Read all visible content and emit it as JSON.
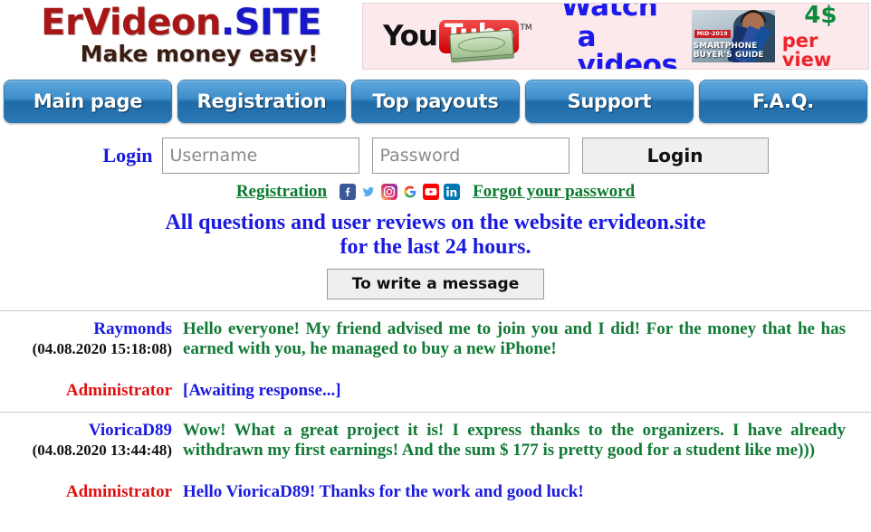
{
  "site": {
    "logo_primary": "ErVideon",
    "logo_dot": ".",
    "logo_suffix": "SITE",
    "logo_tagline": "Make money easy!"
  },
  "banner": {
    "brand_you": "You",
    "brand_tube": "Tube",
    "trademark": "TM",
    "headline_line1": "Watch",
    "headline_line2": "a videos",
    "thumb_tag": "MID-2019",
    "thumb_title": "SMARTPHONE\nBUYER'S GUIDE",
    "price": "4$",
    "price_sub": "per view"
  },
  "nav": {
    "items": [
      {
        "label": "Main page",
        "name": "nav-main-page"
      },
      {
        "label": "Registration",
        "name": "nav-registration"
      },
      {
        "label": "Top payouts",
        "name": "nav-top-payouts"
      },
      {
        "label": "Support",
        "name": "nav-support"
      },
      {
        "label": "F.A.Q.",
        "name": "nav-faq"
      }
    ]
  },
  "login": {
    "label": "Login",
    "username_placeholder": "Username",
    "username_value": "",
    "password_placeholder": "Password",
    "password_value": "",
    "submit_label": "Login"
  },
  "links": {
    "registration": "Registration",
    "forgot": "Forgot your password",
    "social": [
      {
        "name": "facebook-icon",
        "label": "Facebook",
        "color": "#3b5998"
      },
      {
        "name": "twitter-icon",
        "label": "Twitter",
        "color": "#55acee"
      },
      {
        "name": "instagram-icon",
        "label": "Instagram",
        "color": "#e1306c"
      },
      {
        "name": "google-icon",
        "label": "Google",
        "color": "#4285f4"
      },
      {
        "name": "youtube-icon",
        "label": "YouTube",
        "color": "#ff0000"
      },
      {
        "name": "linkedin-icon",
        "label": "LinkedIn",
        "color": "#0077b5"
      }
    ]
  },
  "headline": {
    "line1": "All questions and user reviews on the website ervideon.site",
    "line2": "for the last 24 hours."
  },
  "write_message_button": "To write a message",
  "messages": [
    {
      "author": "Raymonds",
      "date": "(04.08.2020 15:18:08)",
      "text": "Hello everyone! My friend advised me to join you and I did! For the money that he has earned with you, he managed to buy a new iPhone!",
      "reply_author": "Administrator",
      "reply_text": "[Awaiting response...]"
    },
    {
      "author": "VioricaD89",
      "date": "(04.08.2020 13:44:48)",
      "text": "Wow! What a great project it is! I express thanks to the organizers. I have already withdrawn my first earnings! And the sum $ 177 is pretty good for a student like me)))",
      "reply_author": "Administrator",
      "reply_text": "Hello VioricaD89! Thanks for the work and good luck!"
    }
  ],
  "colors": {
    "link_green": "#0a7a2e",
    "blue": "#1a1ae0",
    "admin_red": "#e01010",
    "message_green": "#117a35",
    "nav_blue": "#2a78b5"
  }
}
